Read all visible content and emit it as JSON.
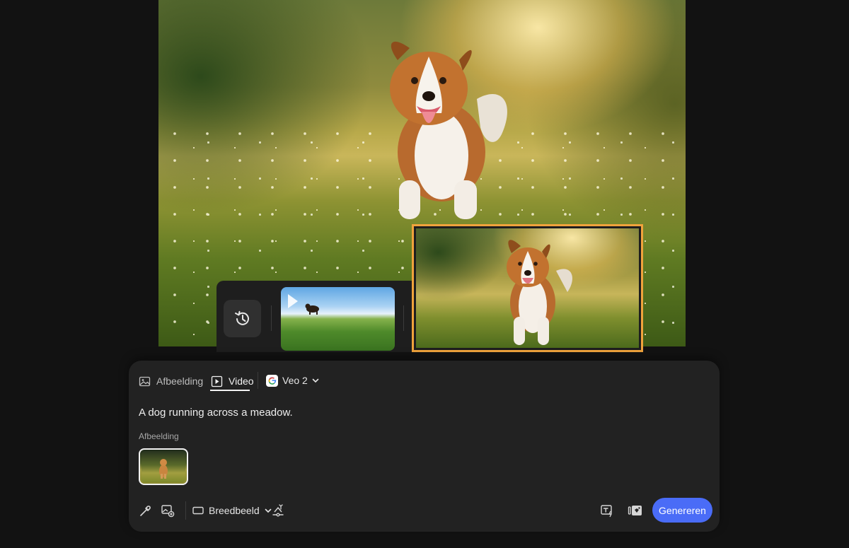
{
  "preview": {
    "main_image_icon": "dog-in-meadow-image",
    "history_icon": "history-icon",
    "thumbnails": [
      {
        "icon": "dog-on-grass-thumbnail",
        "selected": false
      },
      {
        "icon": "dog-in-meadow-thumbnail",
        "selected": true
      }
    ],
    "selected_color": "#f0a33c"
  },
  "panel": {
    "tabs": [
      {
        "label": "Afbeelding",
        "icon": "image-icon",
        "active": false
      },
      {
        "label": "Video",
        "icon": "video-icon",
        "active": true
      }
    ],
    "model": {
      "label": "Veo 2",
      "icon": "google-icon"
    },
    "prompt": "A dog running across a meadow.",
    "image_section_label": "Afbeelding",
    "tools": {
      "aspect_label": "Breedbeeld",
      "left_icons": [
        "eyedropper-icon",
        "add-image-icon",
        "camera-motion-icon"
      ],
      "right_icons": [
        "text-to-image-icon",
        "style-reference-icon"
      ]
    },
    "generate_label": "Genereren",
    "accent_color": "#4a6cf7"
  }
}
